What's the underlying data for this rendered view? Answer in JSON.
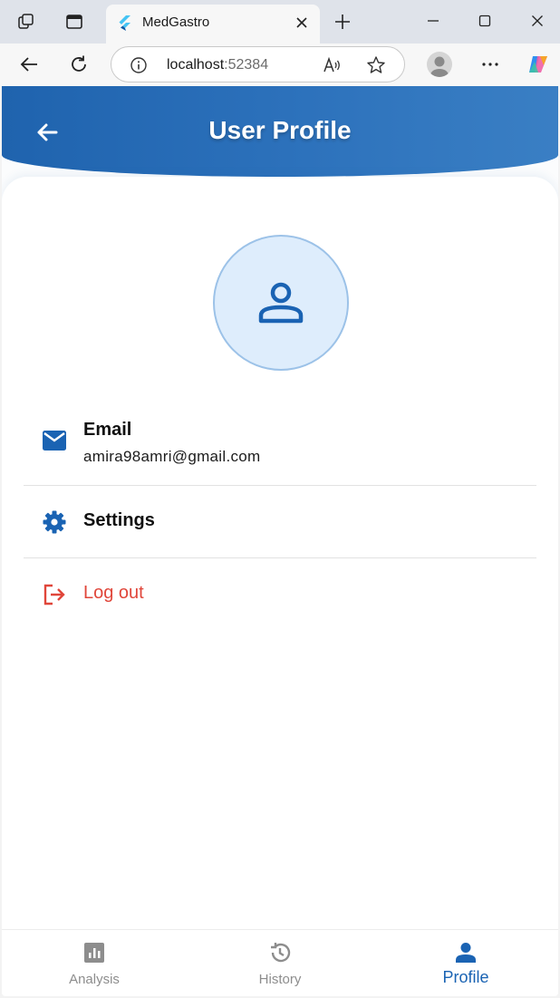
{
  "browser": {
    "tab_title": "MedGastro",
    "address_host": "localhost",
    "address_port": ":52384"
  },
  "app": {
    "title": "User Profile",
    "email": {
      "label": "Email",
      "value": "amira98amri@gmail.com"
    },
    "settings_label": "Settings",
    "logout_label": "Log out",
    "nav": [
      {
        "label": "Analysis",
        "icon": "bar-chart-icon",
        "active": false
      },
      {
        "label": "History",
        "icon": "history-icon",
        "active": false
      },
      {
        "label": "Profile",
        "icon": "person-icon",
        "active": true
      }
    ],
    "colors": {
      "primary": "#1a63b3",
      "logout": "#e0463a",
      "nav_inactive": "#8d8d8d"
    }
  }
}
